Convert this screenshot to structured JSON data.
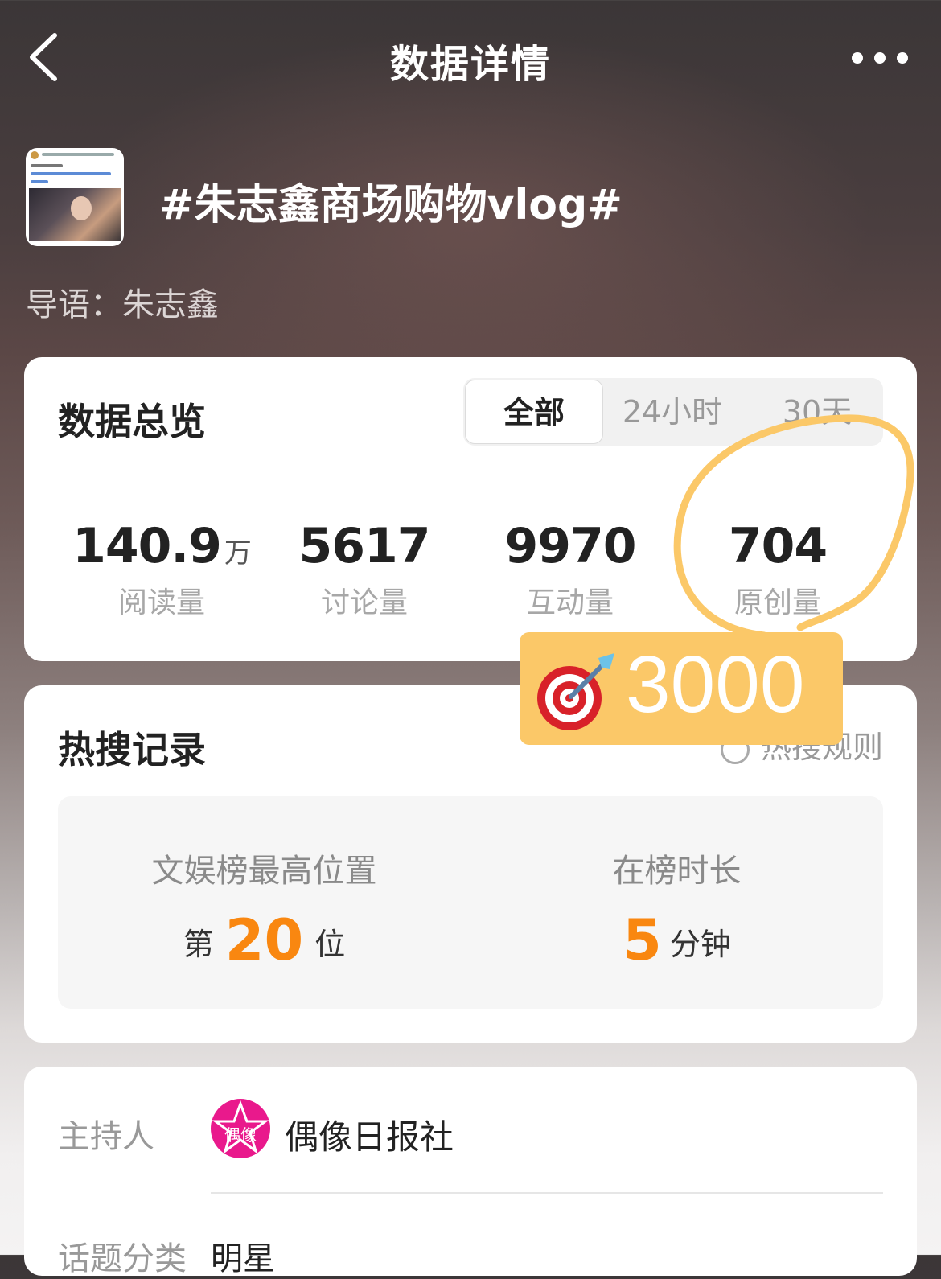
{
  "header": {
    "title": "数据详情"
  },
  "topic": {
    "title": "#朱志鑫商场购物vlog#",
    "intro": "导语：朱志鑫"
  },
  "overview": {
    "title": "数据总览",
    "tabs": [
      "全部",
      "24小时",
      "30天"
    ],
    "active_tab": "全部",
    "stats": [
      {
        "value": "140.9",
        "unit": "万",
        "label": "阅读量"
      },
      {
        "value": "5617",
        "unit": "",
        "label": "讨论量"
      },
      {
        "value": "9970",
        "unit": "",
        "label": "互动量"
      },
      {
        "value": "704",
        "unit": "",
        "label": "原创量"
      }
    ]
  },
  "hot_search": {
    "title": "热搜记录",
    "rule_link": "热搜规则",
    "best_position": {
      "label": "文娱榜最高位置",
      "prefix": "第",
      "value": "20",
      "suffix": "位"
    },
    "duration": {
      "label": "在榜时长",
      "value": "5",
      "suffix": "分钟"
    }
  },
  "info": {
    "host_label": "主持人",
    "host_avatar_text": "偶像",
    "host_name": "偶像日报社",
    "category_label": "话题分类",
    "category_value": "明星"
  },
  "annotation": {
    "sticker_text": "3000",
    "circle_color": "#fbc868",
    "sticker_color": "#fbc868"
  }
}
